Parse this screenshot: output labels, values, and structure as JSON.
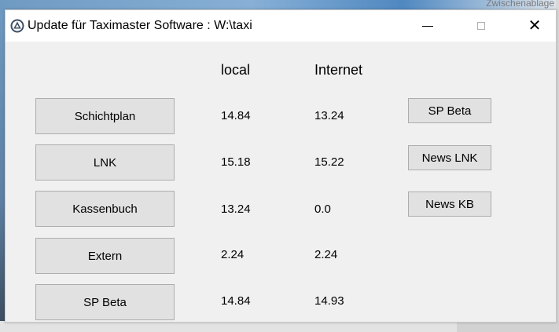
{
  "window": {
    "title": "Update für Taximaster Software : W:\\taxi",
    "background_hint": "Zwischenablage"
  },
  "columns": {
    "local": "local",
    "internet": "Internet"
  },
  "rows": [
    {
      "label": "Schichtplan",
      "local": "14.84",
      "internet": "13.24"
    },
    {
      "label": "LNK",
      "local": "15.18",
      "internet": "15.22"
    },
    {
      "label": "Kassenbuch",
      "local": "13.24",
      "internet": "0.0"
    },
    {
      "label": "Extern",
      "local": "2.24",
      "internet": "2.24"
    },
    {
      "label": "SP Beta",
      "local": "14.84",
      "internet": "14.93"
    }
  ],
  "side_buttons": [
    {
      "label": "SP Beta"
    },
    {
      "label": "News LNK"
    },
    {
      "label": "News KB"
    }
  ],
  "colors": {
    "window_bg": "#f0f0f0",
    "button_bg": "#e1e1e1",
    "button_border": "#adadad",
    "titlebar_bg": "#ffffff"
  },
  "icons": {
    "app": "taximaster-app-icon",
    "minimize": "minimize-icon",
    "maximize": "maximize-icon",
    "close": "close-icon"
  }
}
